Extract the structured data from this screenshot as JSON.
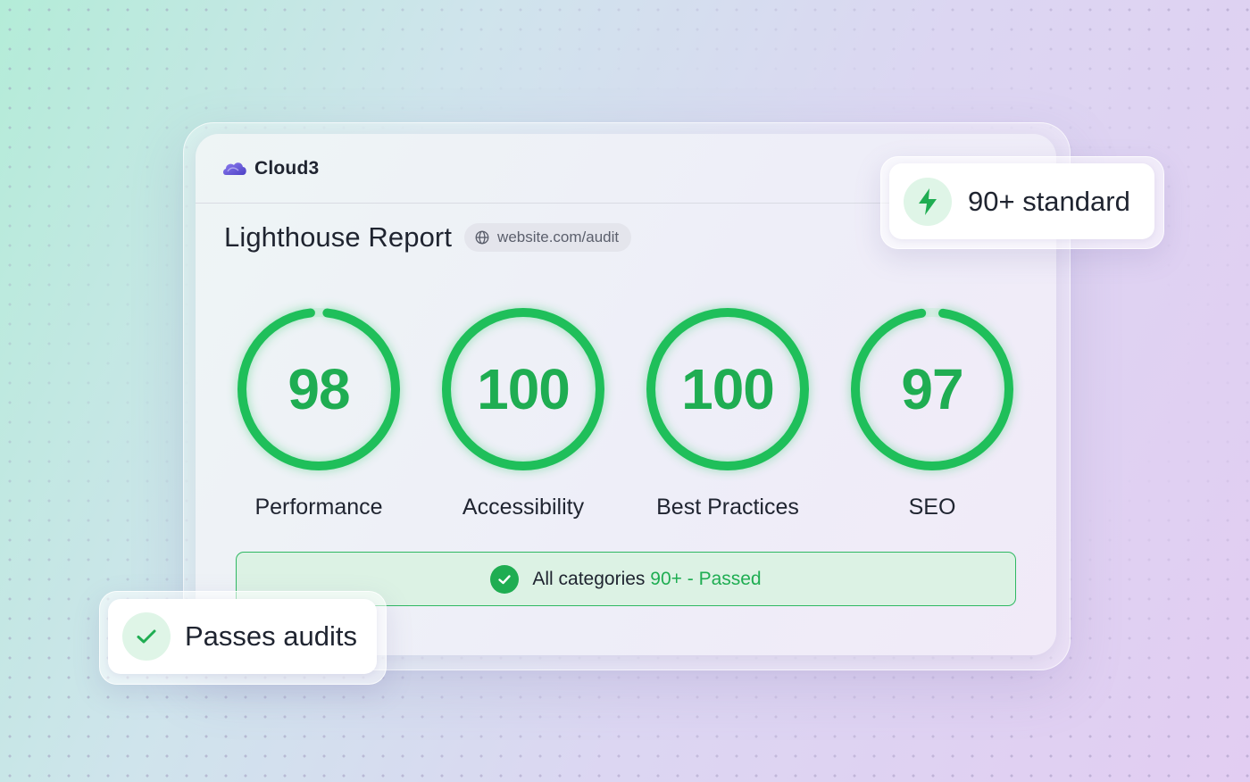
{
  "colors": {
    "accent_green": "#1fad52",
    "pass_bg": "#dcf2e4",
    "text_dark": "#1f2430"
  },
  "brand": {
    "name": "Cloud3",
    "logo_icon": "cloud-icon"
  },
  "report": {
    "title": "Lighthouse Report",
    "url_icon": "globe-icon",
    "url": "website.com/audit"
  },
  "gauges": [
    {
      "label": "Performance",
      "score": "98",
      "value": 98
    },
    {
      "label": "Accessibility",
      "score": "100",
      "value": 100
    },
    {
      "label": "Best Practices",
      "score": "100",
      "value": 100
    },
    {
      "label": "SEO",
      "score": "97",
      "value": 97
    }
  ],
  "status": {
    "icon": "check-circle-icon",
    "prefix": "All categories ",
    "highlight": "90+ - Passed"
  },
  "badges": {
    "standard": {
      "icon": "lightning-icon",
      "text": "90+ standard"
    },
    "audits": {
      "icon": "check-icon",
      "text": "Passes audits"
    }
  }
}
